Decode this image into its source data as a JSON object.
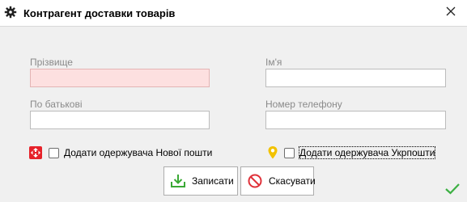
{
  "window": {
    "title": "Контрагент доставки товарів",
    "title_icon": "gear-icon",
    "close_icon": "close-icon"
  },
  "fields": {
    "surname": {
      "label": "Прізвище",
      "value": ""
    },
    "name": {
      "label": "Ім'я",
      "value": ""
    },
    "patronymic": {
      "label": "По батькові",
      "value": ""
    },
    "phone": {
      "label": "Номер телефону",
      "value": ""
    }
  },
  "options": {
    "nova_poshta": {
      "label": "Додати одержувача Нової пошти",
      "checked": false,
      "icon": "nova-poshta-logo-icon",
      "color": "#e6222a"
    },
    "ukrposhta": {
      "label": "Додати одержувача Укрпошти",
      "checked": false,
      "icon": "ukrposhta-logo-icon",
      "color": "#f2c200"
    }
  },
  "actions": {
    "save_label": "Записати",
    "cancel_label": "Скасувати",
    "save_icon": "download-icon",
    "cancel_icon": "cancel-icon"
  },
  "status": {
    "icon": "check-icon",
    "color": "#3cb043"
  }
}
